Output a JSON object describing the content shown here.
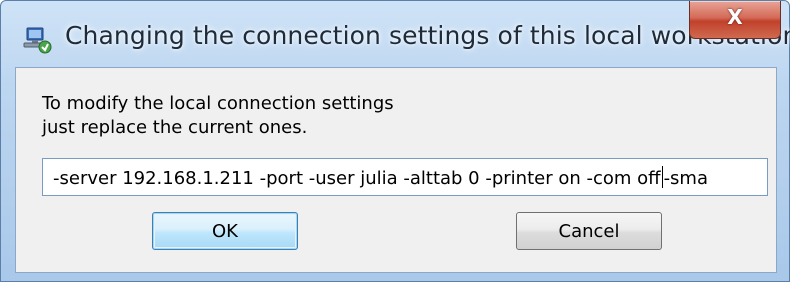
{
  "window": {
    "title": "Changing the connection settings of this local workstation",
    "close_glyph": "X",
    "app_icon": "remote-computer-icon",
    "close_icon": "close-icon"
  },
  "dialog": {
    "message_line1": "To modify the local connection settings",
    "message_line2": "just replace the current ones.",
    "input_value_before_caret": "-server 192.168.1.211 -port  -user julia -alttab 0 -printer on -com off",
    "input_value_after_caret": "-sma"
  },
  "buttons": {
    "ok_label": "OK",
    "cancel_label": "Cancel"
  },
  "colors": {
    "titlebar": "#bdd6f0",
    "close_button": "#c1412b",
    "client_background": "#f0f0f0",
    "default_button_border": "#3c7fb1"
  }
}
